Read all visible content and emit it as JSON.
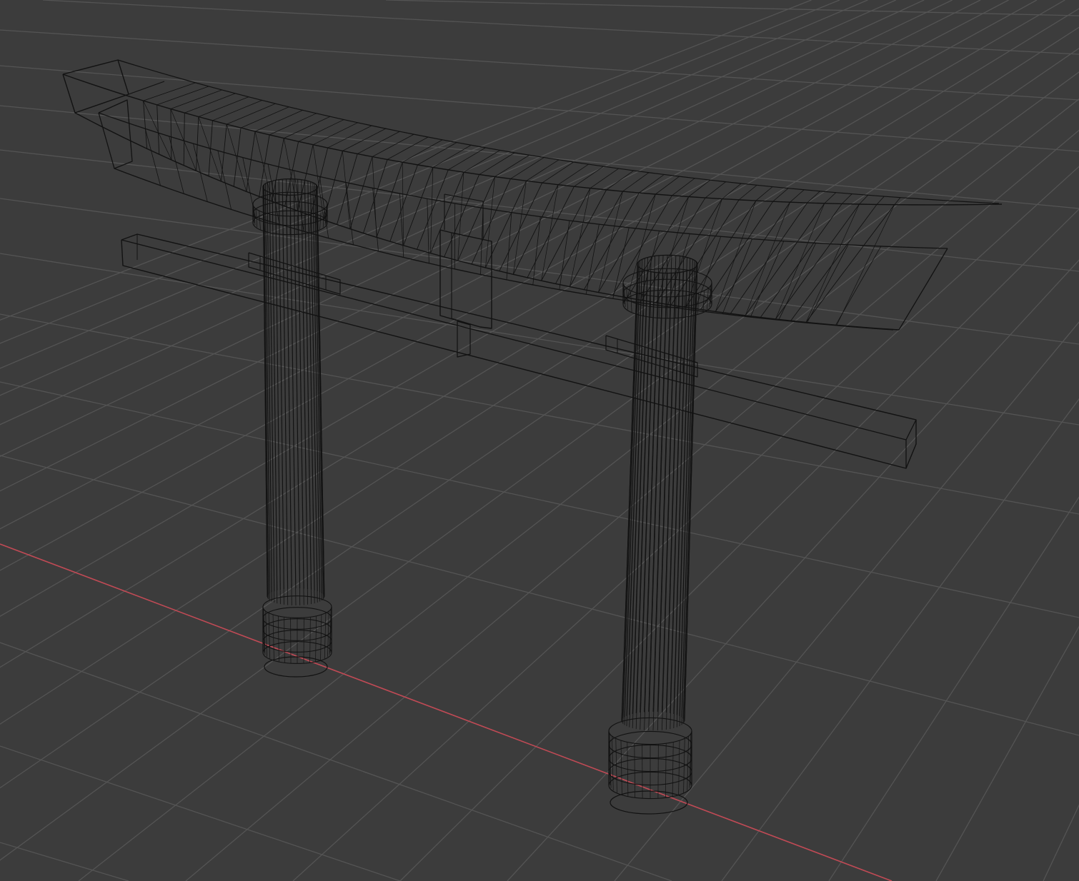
{
  "viewport": {
    "mode": "wireframe",
    "background_color": "#3c3c3c",
    "grid_color": "#545454",
    "x_axis_color": "#c04a55",
    "wire_color": "#121212"
  },
  "scene": {
    "object": "torii-gate",
    "parts": [
      "kasagi",
      "shimaki",
      "nuki",
      "gakuzuka",
      "hashira-left",
      "hashira-right",
      "kusabi-left",
      "kusabi-right",
      "nemaki-left",
      "nemaki-right",
      "daiwa-left",
      "daiwa-right"
    ]
  }
}
